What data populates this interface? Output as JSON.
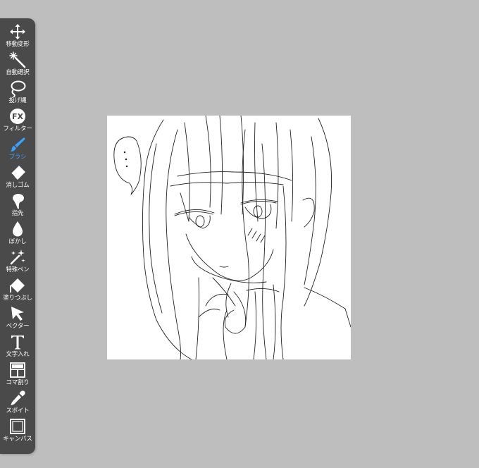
{
  "toolbar": {
    "accent_color": "#3aa0ff",
    "tools": [
      {
        "icon": "move-transform-icon",
        "label": "移動変形"
      },
      {
        "icon": "magic-wand-icon",
        "label": "自動選択"
      },
      {
        "icon": "lasso-icon",
        "label": "投げ縄"
      },
      {
        "icon": "fx-filter-icon",
        "label": "フィルター"
      },
      {
        "icon": "brush-icon",
        "label": "ブラシ",
        "active": true
      },
      {
        "icon": "eraser-icon",
        "label": "消しゴム"
      },
      {
        "icon": "smudge-finger-icon",
        "label": "指先"
      },
      {
        "icon": "blur-drop-icon",
        "label": "ぼかし"
      },
      {
        "icon": "special-pen-icon",
        "label": "特殊ペン"
      },
      {
        "icon": "fill-bucket-icon",
        "label": "塗りつぶし"
      },
      {
        "icon": "vector-cursor-icon",
        "label": "ベクター"
      },
      {
        "icon": "text-tool-icon",
        "label": "文字入れ"
      },
      {
        "icon": "frame-divider-icon",
        "label": "コマ割り"
      },
      {
        "icon": "eyedropper-icon",
        "label": "スポイト"
      },
      {
        "icon": "canvas-icon",
        "label": "キャンバス"
      }
    ]
  }
}
